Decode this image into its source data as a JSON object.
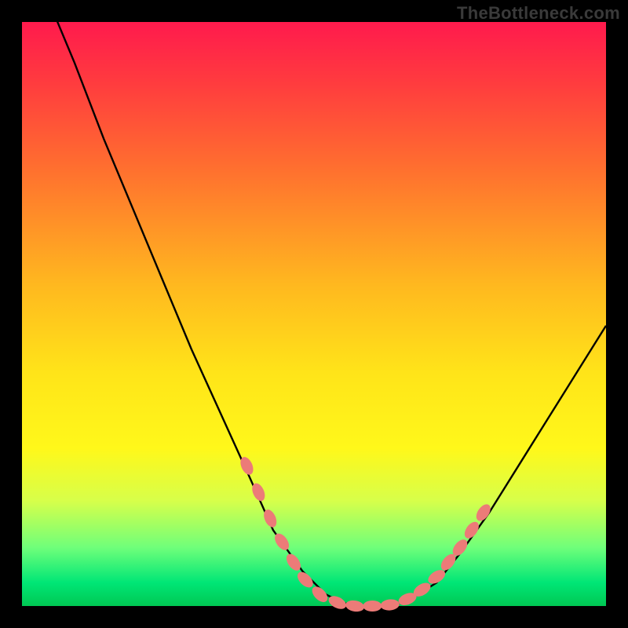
{
  "watermark": "TheBottleneck.com",
  "colors": {
    "background": "#000000",
    "curve_stroke": "#000000",
    "marker_fill": "#ec7b78",
    "marker_stroke": "#4a0f0f"
  },
  "chart_data": {
    "type": "line",
    "title": "",
    "xlabel": "",
    "ylabel": "",
    "xlim": [
      0,
      100
    ],
    "ylim": [
      0,
      100
    ],
    "x": [
      0,
      4,
      9,
      14,
      19,
      24,
      29,
      34,
      39,
      43,
      48,
      52,
      55,
      58,
      61,
      64,
      67,
      71,
      75,
      80,
      85,
      90,
      95,
      100
    ],
    "values": [
      115,
      105,
      93,
      80,
      68,
      56,
      44,
      33,
      22,
      13,
      6,
      2,
      0.5,
      0,
      0,
      0.3,
      1.5,
      4,
      9,
      16,
      24,
      32,
      40,
      48
    ],
    "markers": [
      {
        "x": 38.5,
        "y": 24
      },
      {
        "x": 40.5,
        "y": 19.5
      },
      {
        "x": 42.5,
        "y": 15
      },
      {
        "x": 44.5,
        "y": 11
      },
      {
        "x": 46.5,
        "y": 7.5
      },
      {
        "x": 48.5,
        "y": 4.5
      },
      {
        "x": 51,
        "y": 2
      },
      {
        "x": 54,
        "y": 0.6
      },
      {
        "x": 57,
        "y": 0
      },
      {
        "x": 60,
        "y": 0
      },
      {
        "x": 63,
        "y": 0.2
      },
      {
        "x": 66,
        "y": 1.2
      },
      {
        "x": 68.5,
        "y": 2.8
      },
      {
        "x": 71,
        "y": 5
      },
      {
        "x": 73,
        "y": 7.5
      },
      {
        "x": 75,
        "y": 10
      },
      {
        "x": 77,
        "y": 13
      },
      {
        "x": 79,
        "y": 16
      }
    ]
  }
}
